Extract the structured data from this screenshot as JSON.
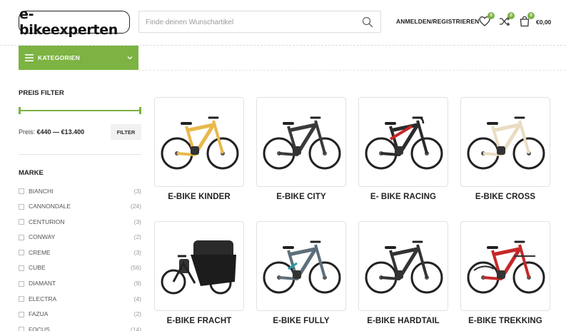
{
  "header": {
    "logo_text": "e-bikeexperten",
    "search_placeholder": "Finde deinen Wunschartikel",
    "login_label": "ANMELDEN/REGISTRIEREN",
    "wishlist_count": "0",
    "compare_count": "0",
    "cart_count": "0",
    "cart_total": "€0,00"
  },
  "category_bar": {
    "label": "KATEGORIEN"
  },
  "sidebar": {
    "price_filter_title": "PREIS FILTER",
    "price_prefix": "Preis:",
    "price_range": "€440 — €13.400",
    "filter_button": "FILTER",
    "brand_title": "MARKE",
    "brands": [
      {
        "name": "BIANCHI",
        "count": "(3)"
      },
      {
        "name": "CANNONDALE",
        "count": "(24)"
      },
      {
        "name": "CENTURION",
        "count": "(3)"
      },
      {
        "name": "CONWAY",
        "count": "(2)"
      },
      {
        "name": "CREME",
        "count": "(3)"
      },
      {
        "name": "CUBE",
        "count": "(56)"
      },
      {
        "name": "DIAMANT",
        "count": "(9)"
      },
      {
        "name": "ELECTRA",
        "count": "(4)"
      },
      {
        "name": "FAZUA",
        "count": "(2)"
      },
      {
        "name": "FOCUS",
        "count": "(14)"
      }
    ]
  },
  "products": [
    {
      "title": "E-BIKE KINDER",
      "icon": "kids-ebike-image",
      "frame_color": "#e8b84a"
    },
    {
      "title": "E-BIKE CITY",
      "icon": "city-ebike-image",
      "frame_color": "#3a3a3a"
    },
    {
      "title": "E- BIKE RACING",
      "icon": "racing-ebike-image",
      "frame_color": "#2b2b2b"
    },
    {
      "title": "E-BIKE CROSS",
      "icon": "cross-ebike-image",
      "frame_color": "#e9dcc2"
    },
    {
      "title": "E-BIKE FRACHT",
      "icon": "cargo-ebike-image",
      "frame_color": "#1f1f1f"
    },
    {
      "title": "E-BIKE FULLY",
      "icon": "fully-ebike-image",
      "frame_color": "#5d6f7a"
    },
    {
      "title": "E-BIKE HARDTAIL",
      "icon": "hardtail-ebike-image",
      "frame_color": "#333333"
    },
    {
      "title": "E-BIKE TREKKING",
      "icon": "trekking-ebike-image",
      "frame_color": "#c62828"
    }
  ],
  "colors": {
    "accent": "#7cb342",
    "text_dark": "#222222",
    "border": "#e2e2e2"
  }
}
